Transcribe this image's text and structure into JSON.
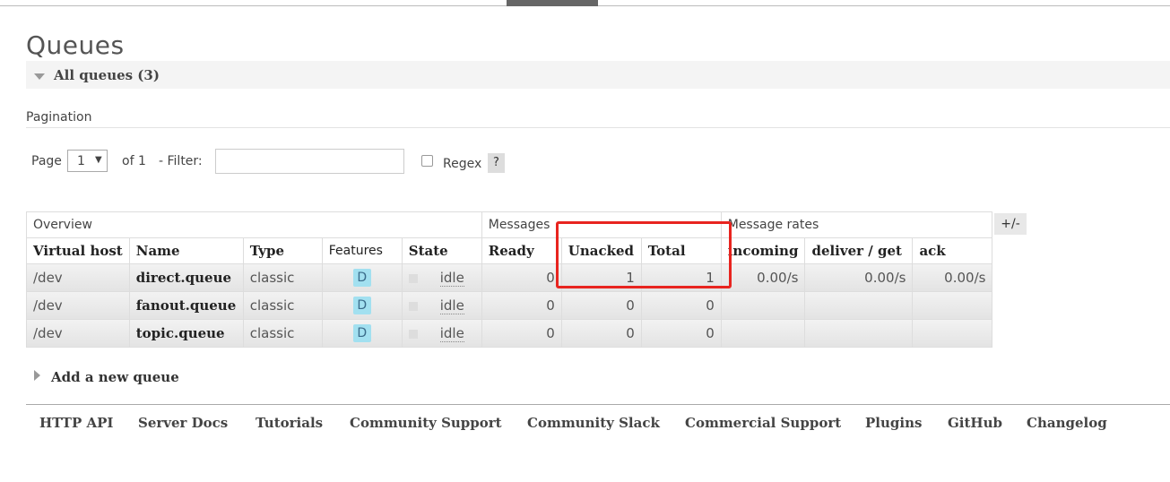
{
  "page": {
    "title": "Queues"
  },
  "section": {
    "label": "All queues (3)"
  },
  "pagination": {
    "heading": "Pagination",
    "page_label": "Page",
    "page_value": "1",
    "of_label": "of 1",
    "filter_label": "- Filter:",
    "filter_value": "",
    "regex_label": "Regex",
    "help_label": "?"
  },
  "table": {
    "groups": [
      "Overview",
      "Messages",
      "Message rates"
    ],
    "columns": [
      "Virtual host",
      "Name",
      "Type",
      "Features",
      "State",
      "Ready",
      "Unacked",
      "Total",
      "incoming",
      "deliver / get",
      "ack"
    ],
    "rows": [
      {
        "vhost": "/dev",
        "name": "direct.queue",
        "type": "classic",
        "feature": "D",
        "state": "idle",
        "ready": "0",
        "unacked": "1",
        "total": "1",
        "incoming": "0.00/s",
        "deliver": "0.00/s",
        "ack": "0.00/s"
      },
      {
        "vhost": "/dev",
        "name": "fanout.queue",
        "type": "classic",
        "feature": "D",
        "state": "idle",
        "ready": "0",
        "unacked": "0",
        "total": "0",
        "incoming": "",
        "deliver": "",
        "ack": ""
      },
      {
        "vhost": "/dev",
        "name": "topic.queue",
        "type": "classic",
        "feature": "D",
        "state": "idle",
        "ready": "0",
        "unacked": "0",
        "total": "0",
        "incoming": "",
        "deliver": "",
        "ack": ""
      }
    ],
    "toggle_label": "+/-"
  },
  "add_queue": {
    "label": "Add a new queue"
  },
  "footer": {
    "links": [
      "HTTP API",
      "Server Docs",
      "Tutorials",
      "Community Support",
      "Community Slack",
      "Commercial Support",
      "Plugins",
      "GitHub",
      "Changelog"
    ]
  },
  "colors": {
    "highlight": "#e8241f",
    "badge": "#a2e0f0"
  },
  "icons": {
    "section_toggle": "triangle-down-icon",
    "add_queue_toggle": "triangle-right-icon"
  }
}
